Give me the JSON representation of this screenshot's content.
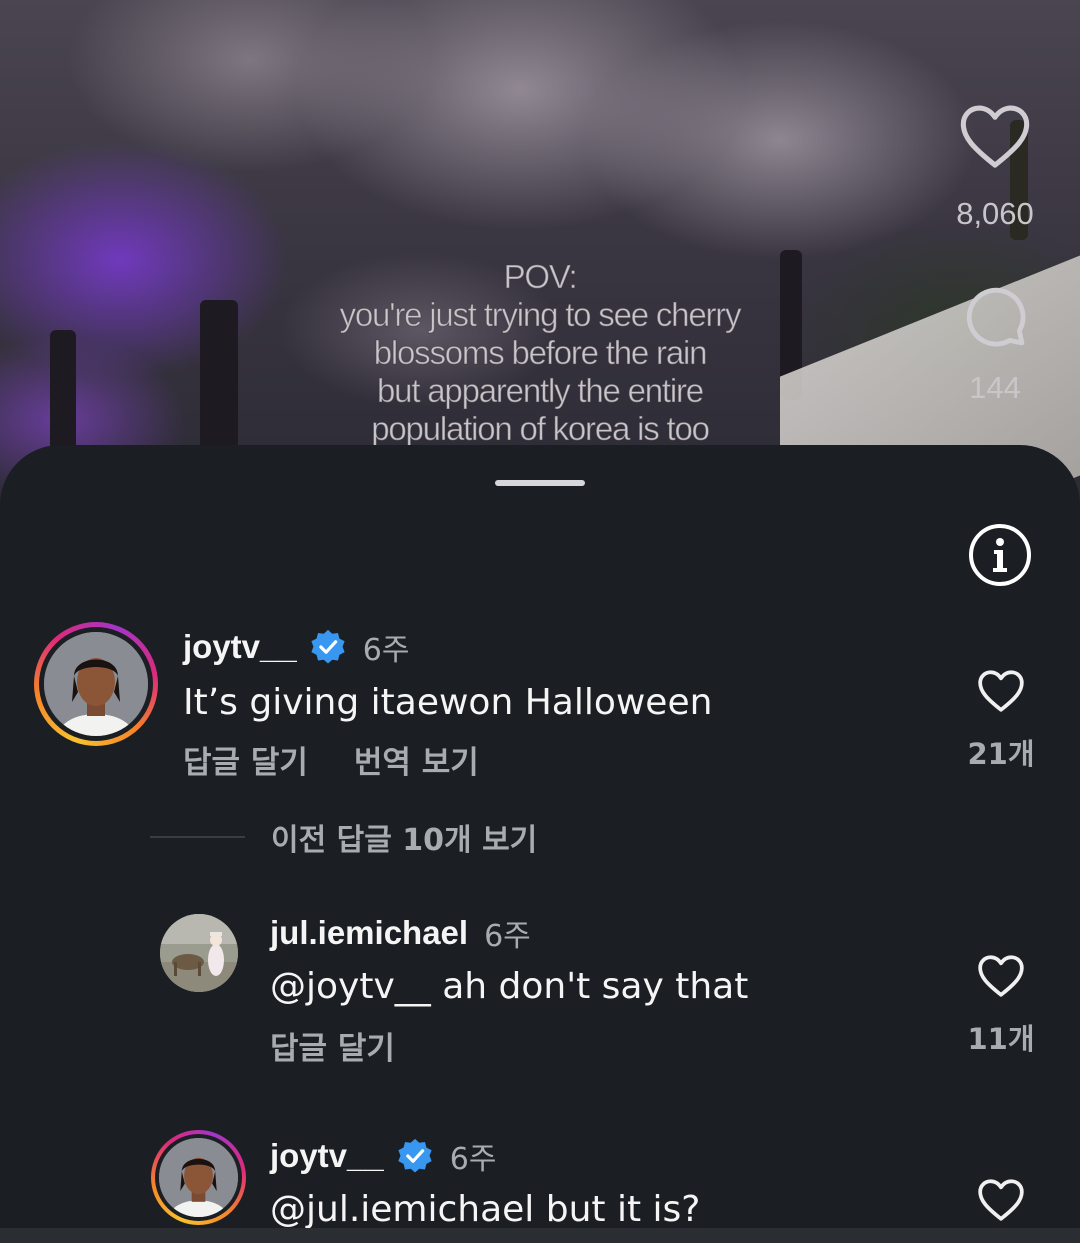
{
  "video": {
    "overlay_lines": [
      "POV:",
      "you're just trying to see cherry",
      "blossoms before the rain",
      "but apparently the entire",
      "population of korea is too"
    ],
    "like_count": "8,060",
    "comment_count": "144",
    "icons": {
      "like": "heart-outline-icon",
      "comment": "speech-bubble-icon"
    }
  },
  "sheet": {
    "info_icon": "info-circle-icon",
    "comments": [
      {
        "username": "joytv__",
        "verified": true,
        "time": "6주",
        "text": "It’s giving itaewon Halloween",
        "reply_label": "답글 달기",
        "translate_label": "번역 보기",
        "like_count": "21개"
      }
    ],
    "view_previous_replies": "이전 답글 10개 보기",
    "replies": [
      {
        "username": "jul.iemichael",
        "verified": false,
        "time": "6주",
        "text": "@joytv__ ah don't say that",
        "reply_label": "답글 달기",
        "like_count": "11개"
      },
      {
        "username": "joytv__",
        "verified": true,
        "time": "6주",
        "text": "@jul.iemichael but it is?"
      }
    ]
  },
  "colors": {
    "sheet_bg": "#1b1f23",
    "verified_blue": "#3897f0",
    "secondary_text": "#a8abb0"
  }
}
